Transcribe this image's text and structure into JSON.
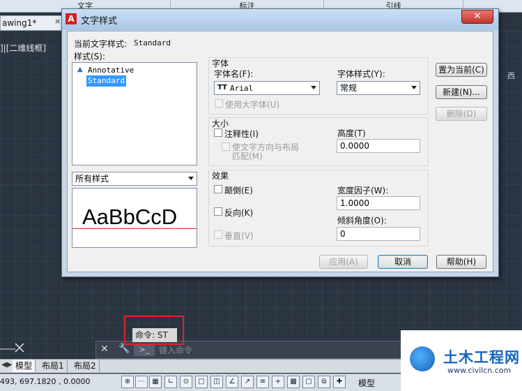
{
  "background": {
    "ribbon_tabs": [
      "文字",
      "标注",
      "引线"
    ],
    "doc_tab": "awing1*",
    "doc_tab_close": "×",
    "viewport_label": "]|[二维线框]",
    "viewcube_label": "西",
    "ucs_icon": "ucs-axis-icon"
  },
  "dialog": {
    "title": "文字样式",
    "close_label": "✕",
    "current_style_label": "当前文字样式:",
    "current_style_value": "Standard",
    "styles_label": "样式(S):",
    "styles": [
      {
        "name": "Annotative",
        "annotative": true,
        "selected": false
      },
      {
        "name": "Standard",
        "annotative": false,
        "selected": true
      }
    ],
    "style_filter": "所有样式",
    "preview_text": "AaBbCcD",
    "font_group": {
      "title": "字体",
      "font_name_label": "字体名(F):",
      "font_name_value": "Arial",
      "font_style_label": "字体样式(Y):",
      "font_style_value": "常规",
      "use_bigfont_label": "使用大字体(U)"
    },
    "size_group": {
      "title": "大小",
      "annotative_label": "注释性(I)",
      "match_orientation_label_line1": "使文字方向与布局",
      "match_orientation_label_line2": "匹配(M)",
      "height_label": "高度(T)",
      "height_value": "0.0000"
    },
    "effects_group": {
      "title": "效果",
      "upside_down_label": "颠倒(E)",
      "backwards_label": "反向(K)",
      "vertical_label": "垂直(V)",
      "width_factor_label": "宽度因子(W):",
      "width_factor_value": "1.0000",
      "oblique_label": "倾斜角度(O):",
      "oblique_value": "0"
    },
    "buttons": {
      "set_current": "置为当前(C)",
      "new": "新建(N)...",
      "delete": "删除(D)",
      "apply": "应用(A)",
      "cancel": "取消",
      "help": "帮助(H)"
    }
  },
  "command": {
    "tooltip": "命令: ST",
    "close": "✕",
    "wrench": "🔧",
    "prompt_icon": ">_",
    "placeholder": "键入命令"
  },
  "layout_tabs": [
    "模型",
    "布局1",
    "布局2"
  ],
  "status": {
    "coordinates": "493, 697.1820 , 0.0000",
    "model_label": "模型"
  },
  "logo": {
    "name": "土木工程网",
    "url": "www.civilcn.com"
  },
  "colors": {
    "selection": "#3399ff",
    "highlight_box": "#e02424",
    "preview_baseline": "#d62b2b",
    "logo_blue": "#1565c0"
  }
}
